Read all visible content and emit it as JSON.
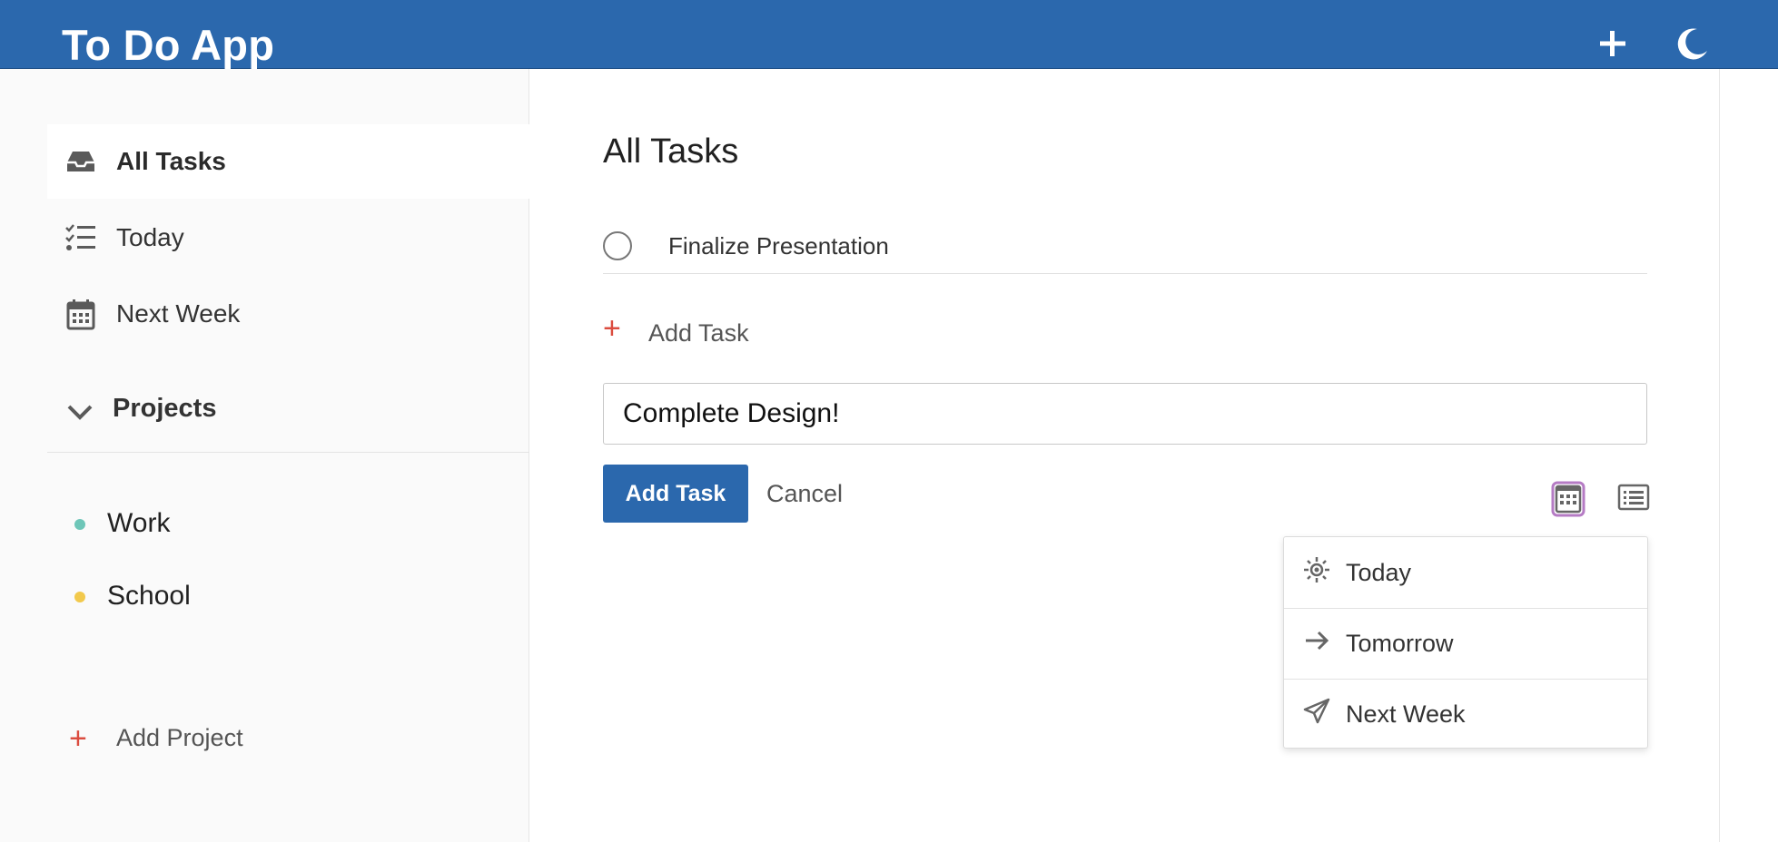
{
  "header": {
    "title": "To Do App",
    "add_icon": "plus-icon",
    "theme_icon": "moon-icon",
    "background": "#2b68ad"
  },
  "sidebar": {
    "items": [
      {
        "label": "All Tasks",
        "icon": "inbox-icon",
        "active": true
      },
      {
        "label": "Today",
        "icon": "checklist-icon",
        "active": false
      },
      {
        "label": "Next Week",
        "icon": "calendar-icon",
        "active": false
      }
    ],
    "projects_label": "Projects",
    "projects": [
      {
        "label": "Work",
        "color": "#6ec6b8"
      },
      {
        "label": "School",
        "color": "#f2c94c"
      }
    ],
    "add_project_label": "Add Project"
  },
  "main": {
    "title": "All Tasks",
    "tasks": [
      {
        "text": "Finalize Presentation",
        "done": false
      }
    ],
    "add_task_link": "Add Task",
    "input_value": "Complete Design!",
    "add_task_button": "Add Task",
    "cancel_button": "Cancel"
  },
  "date_menu": {
    "items": [
      {
        "label": "Today",
        "icon": "sun-icon"
      },
      {
        "label": "Tomorrow",
        "icon": "arrow-right-icon"
      },
      {
        "label": "Next Week",
        "icon": "paper-plane-icon"
      }
    ]
  },
  "colors": {
    "accent": "#2b68ad",
    "add_plus": "#db4c3f",
    "focus_ring": "#b57bc4"
  }
}
